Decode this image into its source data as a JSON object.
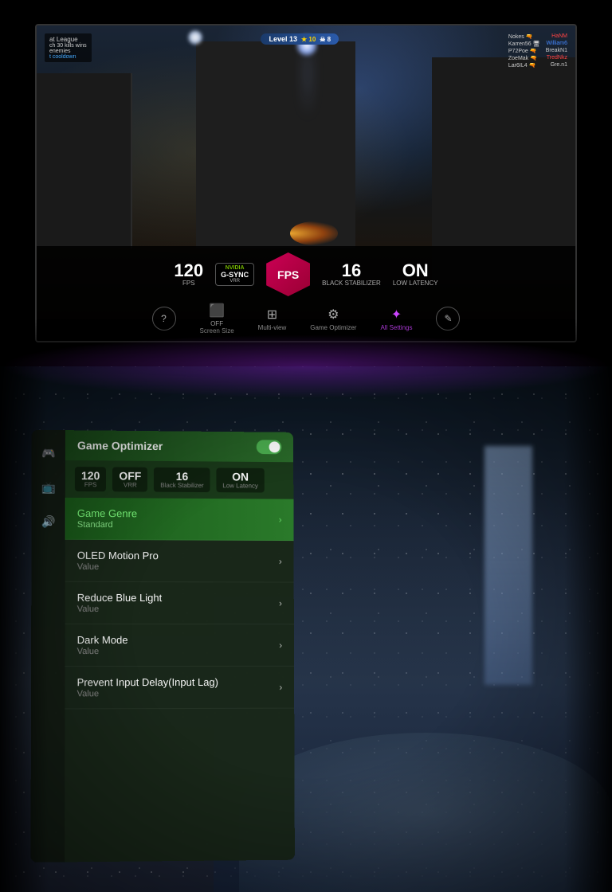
{
  "topSection": {
    "hud": {
      "leftText": "at League\nch 30 kills wins\nenemies\nt cooldown",
      "level": "Level 13",
      "stars": "★ 10",
      "skull": "☠ 8",
      "players": [
        {
          "team1": "Nokes",
          "team1icon": "🔫",
          "team2": "HaNM"
        },
        {
          "team1": "Karren56",
          "team1icon": "🖥",
          "team2": "William6"
        },
        {
          "team1": "P72Poe",
          "team1icon": "🔫",
          "team2": "BreakN1"
        },
        {
          "team1": "ZoeMak",
          "team1icon": "🔫",
          "team2": "TredNkz"
        },
        {
          "team1": "Lar6IL4",
          "team1icon": "🔫",
          "team2": "Gre.n1"
        }
      ]
    },
    "stats": {
      "fps": "120",
      "fps_label": "FPS",
      "vsync_nvidia": "NVIDIA",
      "vsync_name": "G-SYNC",
      "vsync_sub": "VRR",
      "fps_badge": "FPS",
      "black_stabilizer": "16",
      "black_stabilizer_label": "Black Stabilizer",
      "low_latency": "ON",
      "low_latency_label": "Low Latency"
    },
    "controls": [
      {
        "label": "Screen Size",
        "value": "OFF"
      },
      {
        "label": "Multi-view",
        "icon": "⊞"
      },
      {
        "label": "Game Optimizer",
        "icon": "⚙"
      },
      {
        "label": "All Settings",
        "icon": "✦",
        "active": true
      }
    ]
  },
  "bottomSection": {
    "gameOptimizer": {
      "title": "Game Optimizer",
      "toggle_state": "on",
      "stats": [
        {
          "value": "120",
          "label": "FPS"
        },
        {
          "value": "OFF",
          "label": "VRR"
        },
        {
          "value": "16",
          "label": "Black Stabilizer"
        },
        {
          "value": "ON",
          "label": "Low Latency"
        }
      ],
      "menuItems": [
        {
          "name": "Game Genre",
          "value": "Standard",
          "highlighted": true
        },
        {
          "name": "OLED Motion Pro",
          "value": "Value",
          "highlighted": false
        },
        {
          "name": "Reduce Blue Light",
          "value": "Value",
          "highlighted": false
        },
        {
          "name": "Dark Mode",
          "value": "Value",
          "highlighted": false
        },
        {
          "name": "Prevent Input Delay(Input Lag)",
          "value": "Value",
          "highlighted": false
        }
      ]
    },
    "sidebarIcons": [
      {
        "icon": "🎮",
        "active": true
      },
      {
        "icon": "📺",
        "active": false
      },
      {
        "icon": "🔊",
        "active": false
      }
    ]
  }
}
